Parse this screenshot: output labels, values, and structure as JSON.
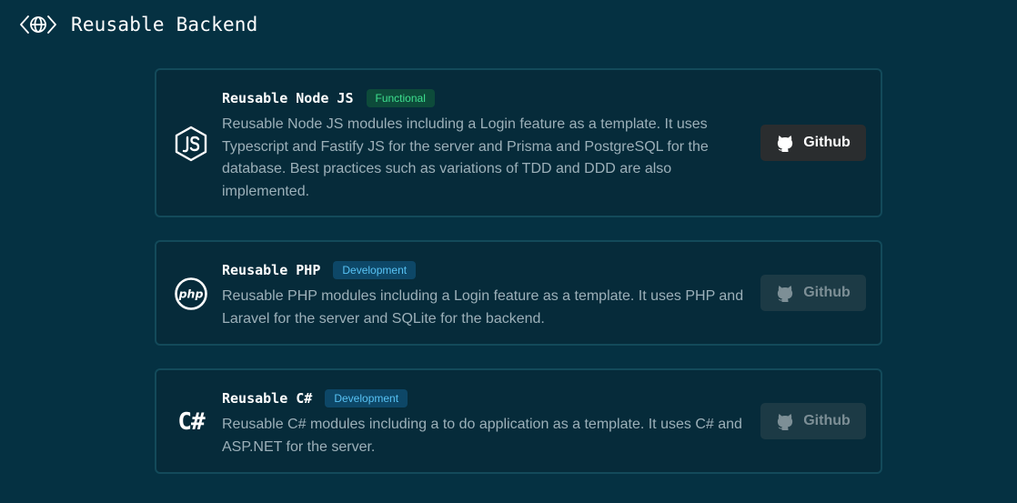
{
  "header": {
    "title": "Reusable Backend",
    "icon": "code-globe-icon"
  },
  "colors": {
    "background": "#053142",
    "card_border": "#134a5a",
    "functional_badge_text": "#3ee08f",
    "development_badge_text": "#58c3f5"
  },
  "projects": [
    {
      "title": "Reusable Node JS",
      "icon": "nodejs-icon",
      "status": "Functional",
      "description": "Reusable Node JS modules including a Login feature as a template. It uses Typescript and Fastify JS for the server and Prisma and PostgreSQL for the database. Best practices such as variations of TDD and DDD are also implemented.",
      "button_label": "Github",
      "button_enabled": true
    },
    {
      "title": "Reusable PHP",
      "icon": "php-icon",
      "status": "Development",
      "description": "Reusable PHP modules including a Login feature as a template. It uses PHP and Laravel for the server and SQLite for the backend.",
      "button_label": "Github",
      "button_enabled": false
    },
    {
      "title": "Reusable C#",
      "icon": "csharp-icon",
      "icon_text": "C#",
      "status": "Development",
      "description": "Reusable C# modules including a to do application as a template. It uses C# and ASP.NET for the server.",
      "button_label": "Github",
      "button_enabled": false
    }
  ]
}
